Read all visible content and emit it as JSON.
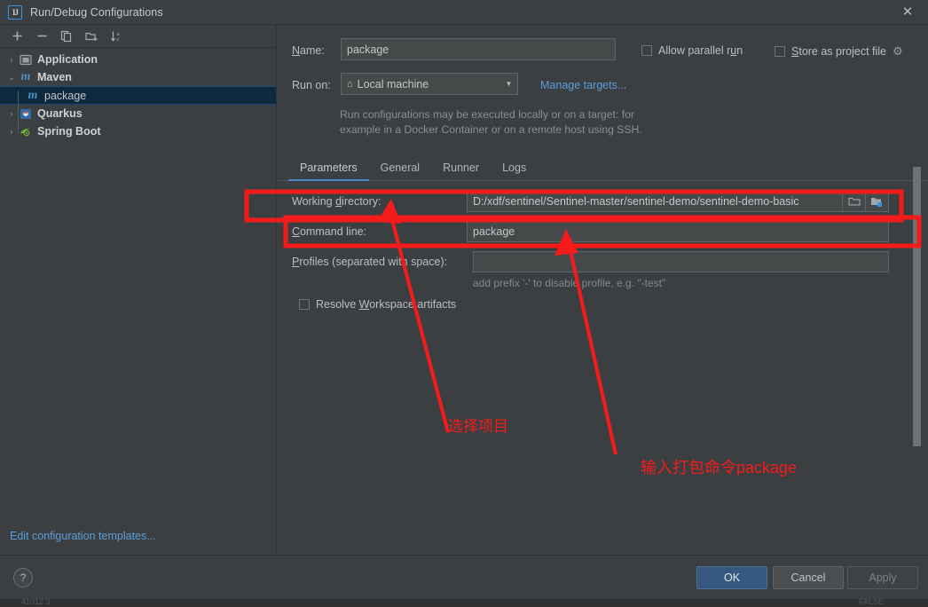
{
  "window": {
    "title": "Run/Debug Configurations",
    "app_icon": "intellij-idea-icon",
    "close_label": "✕"
  },
  "sidebar": {
    "toolbar": [
      {
        "name": "add-configuration-button",
        "glyph": "+"
      },
      {
        "name": "remove-configuration-button",
        "glyph": "−"
      },
      {
        "name": "copy-configuration-button",
        "glyph": "copy-icon"
      },
      {
        "name": "new-folder-button",
        "glyph": "folder-add-icon"
      },
      {
        "name": "sort-configurations-button",
        "glyph": "sort-az-icon"
      }
    ],
    "tree": [
      {
        "label": "Application",
        "icon": "application-icon",
        "twisty": "›",
        "level": 0,
        "selected": false,
        "bold": true
      },
      {
        "label": "Maven",
        "icon": "maven-icon",
        "twisty": "⌄",
        "level": 0,
        "selected": false,
        "bold": true
      },
      {
        "label": "package",
        "icon": "maven-icon",
        "twisty": "",
        "level": 1,
        "selected": true,
        "bold": false
      },
      {
        "label": "Quarkus",
        "icon": "quarkus-icon",
        "twisty": "›",
        "level": 0,
        "selected": false,
        "bold": true
      },
      {
        "label": "Spring Boot",
        "icon": "spring-boot-icon",
        "twisty": "›",
        "level": 0,
        "selected": false,
        "bold": true
      }
    ],
    "edit_templates_link": "Edit configuration templates..."
  },
  "form": {
    "name_label": "Name:",
    "name_label_mnemonic": "N",
    "name_value": "package",
    "allow_parallel_run_label": "Allow parallel run",
    "allow_parallel_run_checked": false,
    "store_as_project_file_label": "Store as project file",
    "store_as_project_file_checked": false,
    "settings_gear_icon": "gear-icon",
    "run_on_label": "Run on:",
    "run_on_value": "Local machine",
    "run_on_icon": "home-icon",
    "manage_targets_link": "Manage targets...",
    "target_hint_line1": "Run configurations may be executed locally or on a target: for",
    "target_hint_line2": "example in a Docker Container or on a remote host using SSH."
  },
  "tabs": [
    {
      "label": "Parameters",
      "active": true
    },
    {
      "label": "General",
      "active": false
    },
    {
      "label": "Runner",
      "active": false
    },
    {
      "label": "Logs",
      "active": false
    }
  ],
  "parameters": {
    "working_directory_label": "Working directory:",
    "working_directory_value": "D:/xdf/sentinel/Sentinel-master/sentinel-demo/sentinel-demo-basic",
    "browse_icon": "folder-open-icon",
    "module_icon": "module-folder-icon",
    "command_line_label": "Command line:",
    "command_line_value": "package",
    "profiles_label": "Profiles (separated with space):",
    "profiles_value": "",
    "profiles_hint": "add prefix '-' to disable profile, e.g. \"-test\"",
    "resolve_workspace_label": "Resolve Workspace artifacts",
    "resolve_workspace_checked": false
  },
  "footer": {
    "help_label": "?",
    "ok_label": "OK",
    "cancel_label": "Cancel",
    "apply_label": "Apply"
  },
  "annotations": {
    "color": "#f51b1b",
    "note_select_project": "选择项目",
    "note_enter_package_command": "输入打包命令package"
  },
  "behind_window": {
    "left_text": "41012  3",
    "right_text": "FALSE"
  }
}
